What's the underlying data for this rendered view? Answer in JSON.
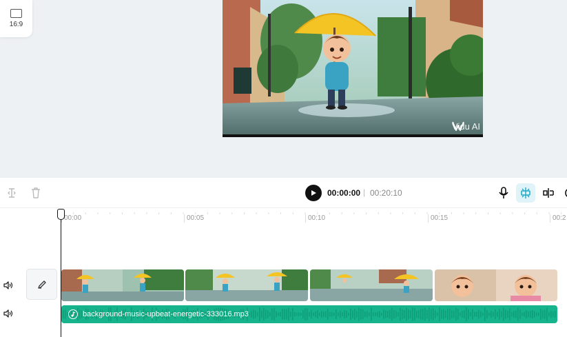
{
  "stage": {
    "aspect_ratio_label": "16:9",
    "watermark_text": "Vidu AI"
  },
  "playback": {
    "current_time": "00:00:00",
    "separator": "|",
    "total_time": "00:20:10"
  },
  "ruler": {
    "ticks": [
      "00:00",
      "00:05",
      "00:10",
      "00:15",
      "00:2"
    ]
  },
  "audio_track": {
    "file_name": "background-music-upbeat-energetic-333016.mp3"
  },
  "colors": {
    "audio_clip": "#15b48c",
    "snap_active": "#dff3f8",
    "stage_bg": "#eef1f4"
  },
  "icons": {
    "split": "split-icon",
    "delete": "trash-icon",
    "play": "play-icon",
    "microphone": "microphone-icon",
    "snap": "magnet-snap-icon",
    "separate": "separate-audio-icon",
    "mute": "speaker-icon",
    "edit": "pencil-icon",
    "audio": "music-note-icon"
  }
}
